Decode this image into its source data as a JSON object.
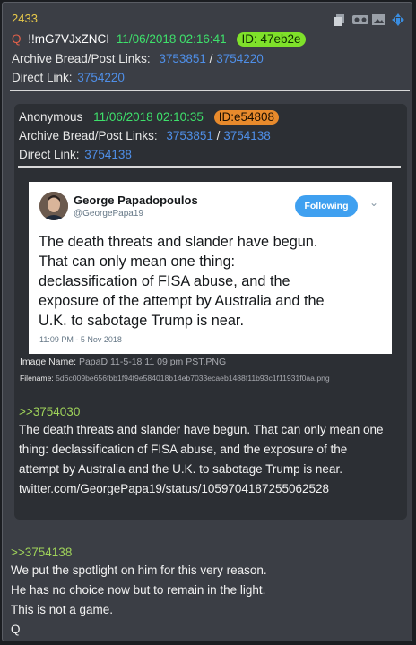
{
  "post": {
    "number": "2433",
    "q_letter": "Q",
    "tripcode": "!!mG7VJxZNCI",
    "date": "11/06/2018 02:16:41",
    "id": "ID: 47eb2e",
    "archive_label": "Archive Bread/Post Links:",
    "archive_link_1": "3753851",
    "separator": "/",
    "archive_link_2": "3754220",
    "direct_label": "Direct Link:",
    "direct_link": "3754220",
    "reply_ref": ">>3754138",
    "body_lines": [
      "We put the spotlight on him for this very reason.",
      "He has no choice now but to remain in the light.",
      "This is not a game.",
      "Q"
    ]
  },
  "toolbar": {
    "icons": [
      "copy-icon",
      "vr-icon",
      "image-icon",
      "move-icon"
    ]
  },
  "quoted_post": {
    "author": "Anonymous",
    "date": "11/06/2018 02:10:35",
    "id": "ID:e54808",
    "archive_label": "Archive Bread/Post Links:",
    "archive_link_1": "3753851",
    "separator": "/",
    "archive_link_2": "3754138",
    "direct_label": "Direct Link:",
    "direct_link": "3754138",
    "image_name_label": "Image Name:",
    "image_name": "PapaD 11-5-18 11 09 pm PST.PNG",
    "filename_label": "Filename:",
    "filename": "5d6c009be656fbb1f94f9e584018b14eb7033ecaeb1488f11b93c1f11931f0aa.png",
    "reply_ref": ">>3754030",
    "body_lines": [
      "The death threats and slander have begun. That can only mean one",
      "thing: declassification of FISA abuse, and the exposure of the",
      "attempt by Australia and the U.K. to sabotage Trump is near.",
      "twitter.com/GeorgePapa19/status/1059704187255062528"
    ]
  },
  "tweet": {
    "name": "George Papadopoulos",
    "handle": "@GeorgePapa19",
    "follow_label": "Following",
    "text_lines": [
      "The death threats and slander have begun.",
      "That can only mean one thing:",
      "declassification of FISA abuse, and the",
      "exposure of the attempt by Australia and the",
      "U.K. to sabotage Trump is near."
    ],
    "timestamp": "11:09 PM - 5 Nov 2018"
  },
  "colors": {
    "post_number": "#e6c84a",
    "date": "#3ee06b",
    "id_main": "#7fe12a",
    "id_quoted": "#e88a2c",
    "links": "#4f8fe8",
    "greentext": "#9fd35a"
  }
}
